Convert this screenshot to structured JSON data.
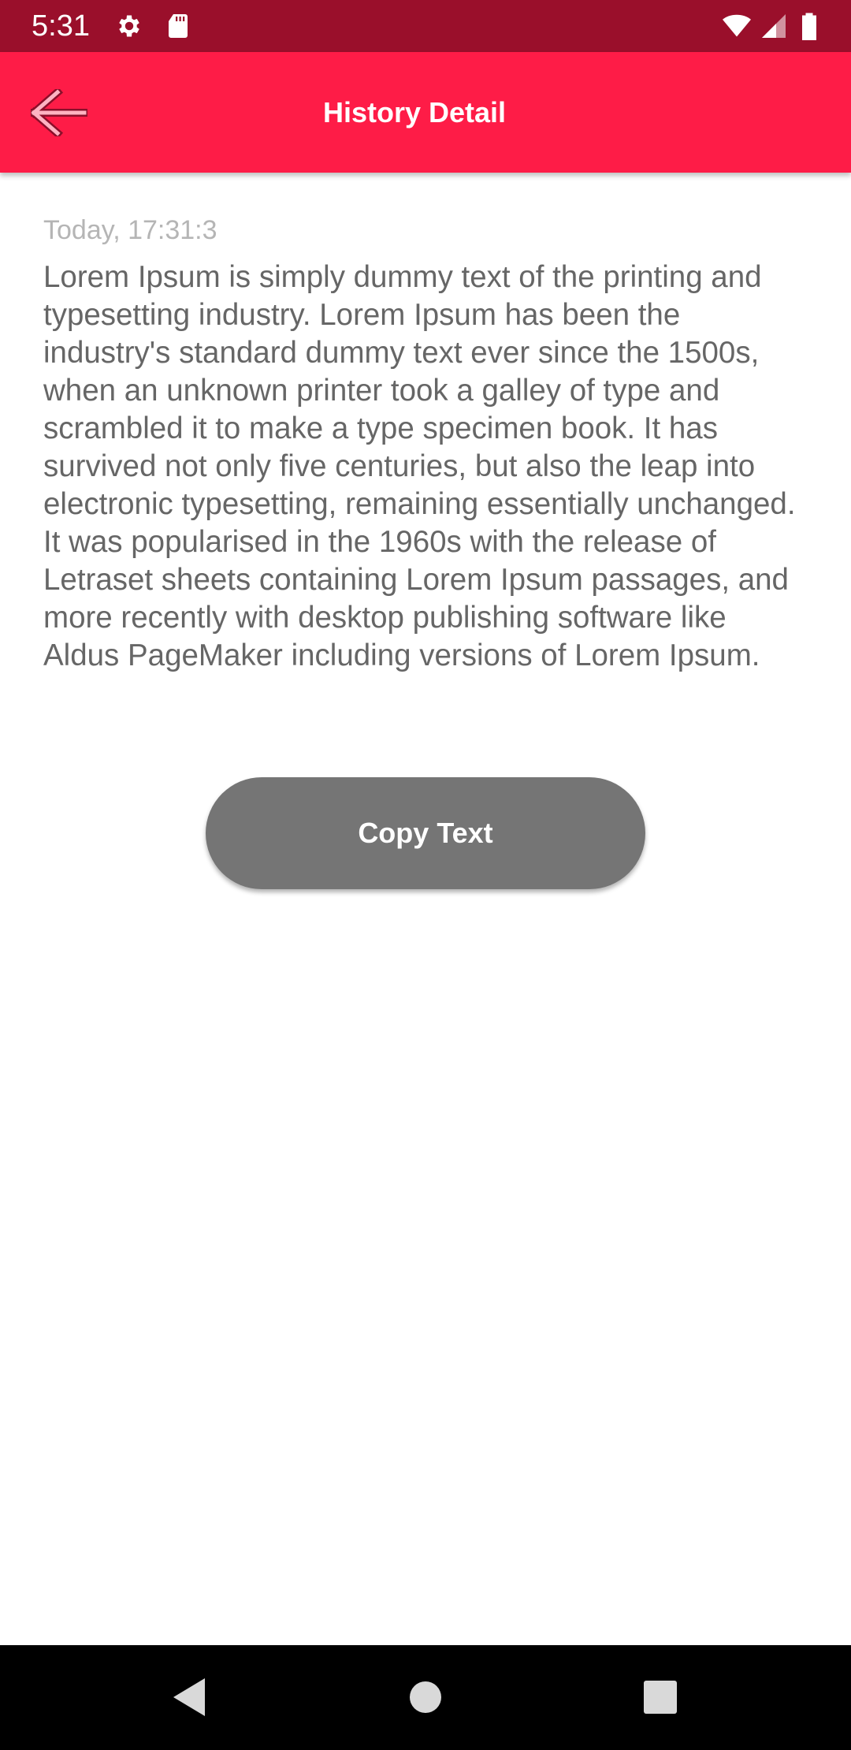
{
  "status_bar": {
    "time": "5:31",
    "icons": [
      "gear-icon",
      "sd-card-icon",
      "wifi-icon",
      "signal-icon",
      "battery-icon"
    ],
    "background_color": "#9a0f2b"
  },
  "app_bar": {
    "title": "History Detail",
    "back_icon": "arrow-left-icon",
    "background_color": "#fe1c47"
  },
  "detail": {
    "timestamp": "Today, 17:31:3",
    "text": "Lorem Ipsum is simply dummy text of the printing and typesetting industry. Lorem Ipsum has been the industry's standard dummy text ever since the 1500s, when an unknown printer took a galley of type and scrambled it to make a type specimen book. It has survived not only five centuries, but also the leap into electronic typesetting, remaining essentially unchanged. It was popularised in the 1960s with the release of Letraset sheets containing Lorem Ipsum passages, and more recently with desktop publishing software like Aldus PageMaker including versions of Lorem Ipsum."
  },
  "actions": {
    "copy_label": "Copy Text",
    "copy_button_color": "#757575"
  },
  "nav_bar": {
    "buttons": [
      "back-triangle-icon",
      "home-circle-icon",
      "recents-square-icon"
    ]
  }
}
